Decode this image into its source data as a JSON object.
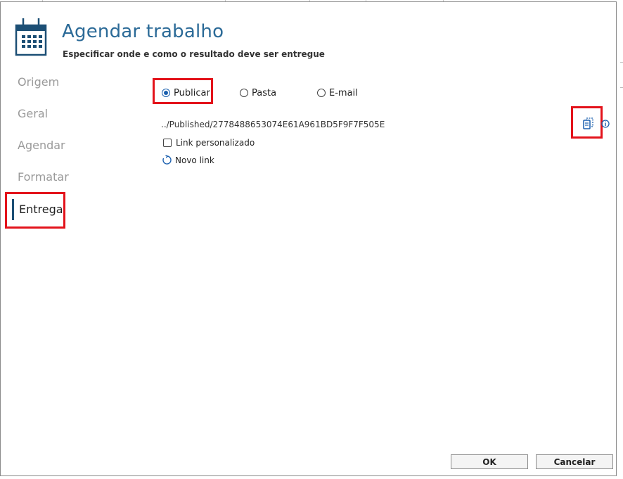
{
  "dialog": {
    "title": "Agendar trabalho",
    "subtitle": "Especificar onde e como o resultado deve ser entregue",
    "header_icon": "calendar-icon"
  },
  "nav": {
    "items": [
      {
        "label": "Origem",
        "active": false
      },
      {
        "label": "Geral",
        "active": false
      },
      {
        "label": "Agendar",
        "active": false
      },
      {
        "label": "Formatar",
        "active": false
      },
      {
        "label": "Entrega",
        "active": true
      }
    ]
  },
  "delivery": {
    "options": [
      {
        "label": "Publicar",
        "selected": true
      },
      {
        "label": "Pasta",
        "selected": false
      },
      {
        "label": "E-mail",
        "selected": false
      }
    ],
    "url": "../Published/2778488653074E61A961BD5F9F7F505E",
    "custom_link_label": "Link personalizado",
    "custom_link_checked": false,
    "new_link_label": "Novo link",
    "copy_icon": "copy-icon",
    "info_icon": "info-icon"
  },
  "footer": {
    "ok_label": "OK",
    "cancel_label": "Cancelar"
  },
  "colors": {
    "title": "#2b6a97",
    "accent": "#1a5fae",
    "nav_active_bar": "#1c4f75",
    "highlight": "#e3131b"
  }
}
